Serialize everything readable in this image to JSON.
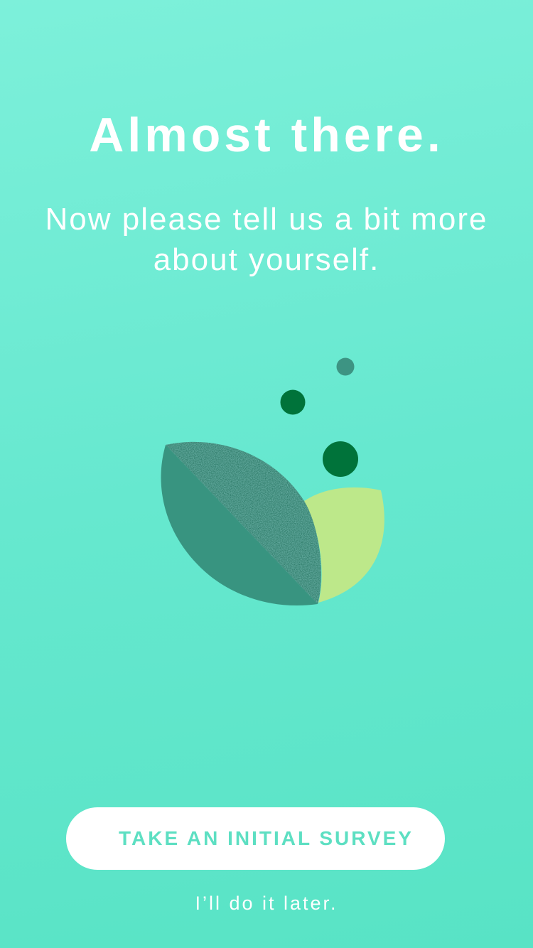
{
  "onboarding": {
    "title": "Almost there.",
    "subtitle": "Now please tell us a bit more about yourself.",
    "primary_button_label": "TAKE AN INITIAL SURVEY",
    "secondary_link_label": "I’ll do it later."
  },
  "illustration": {
    "name": "leaves-and-dots-icon"
  },
  "colors": {
    "background_top": "#7df0da",
    "background_bottom": "#58e3c5",
    "leaf_dark": "#389480",
    "leaf_light": "#bde88a",
    "dot_green": "#00733a",
    "dot_teal": "#3d9483",
    "button_text": "#5ddfc2",
    "text": "#ffffff"
  }
}
